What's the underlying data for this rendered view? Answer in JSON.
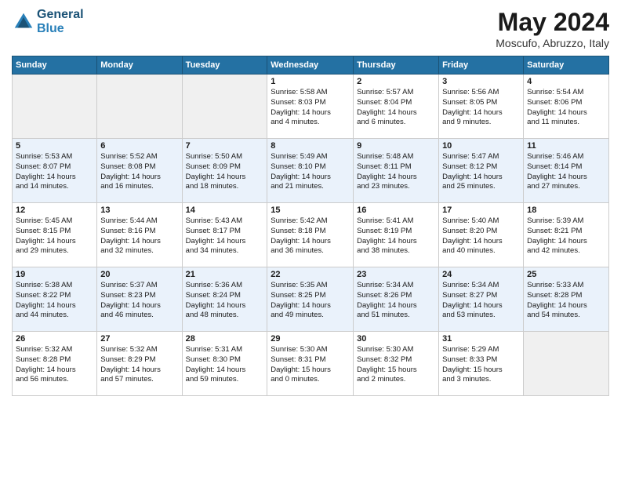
{
  "header": {
    "logo_line1": "General",
    "logo_line2": "Blue",
    "month_year": "May 2024",
    "location": "Moscufo, Abruzzo, Italy"
  },
  "days_of_week": [
    "Sunday",
    "Monday",
    "Tuesday",
    "Wednesday",
    "Thursday",
    "Friday",
    "Saturday"
  ],
  "weeks": [
    [
      {
        "day": "",
        "info": ""
      },
      {
        "day": "",
        "info": ""
      },
      {
        "day": "",
        "info": ""
      },
      {
        "day": "1",
        "info": "Sunrise: 5:58 AM\nSunset: 8:03 PM\nDaylight: 14 hours\nand 4 minutes."
      },
      {
        "day": "2",
        "info": "Sunrise: 5:57 AM\nSunset: 8:04 PM\nDaylight: 14 hours\nand 6 minutes."
      },
      {
        "day": "3",
        "info": "Sunrise: 5:56 AM\nSunset: 8:05 PM\nDaylight: 14 hours\nand 9 minutes."
      },
      {
        "day": "4",
        "info": "Sunrise: 5:54 AM\nSunset: 8:06 PM\nDaylight: 14 hours\nand 11 minutes."
      }
    ],
    [
      {
        "day": "5",
        "info": "Sunrise: 5:53 AM\nSunset: 8:07 PM\nDaylight: 14 hours\nand 14 minutes."
      },
      {
        "day": "6",
        "info": "Sunrise: 5:52 AM\nSunset: 8:08 PM\nDaylight: 14 hours\nand 16 minutes."
      },
      {
        "day": "7",
        "info": "Sunrise: 5:50 AM\nSunset: 8:09 PM\nDaylight: 14 hours\nand 18 minutes."
      },
      {
        "day": "8",
        "info": "Sunrise: 5:49 AM\nSunset: 8:10 PM\nDaylight: 14 hours\nand 21 minutes."
      },
      {
        "day": "9",
        "info": "Sunrise: 5:48 AM\nSunset: 8:11 PM\nDaylight: 14 hours\nand 23 minutes."
      },
      {
        "day": "10",
        "info": "Sunrise: 5:47 AM\nSunset: 8:12 PM\nDaylight: 14 hours\nand 25 minutes."
      },
      {
        "day": "11",
        "info": "Sunrise: 5:46 AM\nSunset: 8:14 PM\nDaylight: 14 hours\nand 27 minutes."
      }
    ],
    [
      {
        "day": "12",
        "info": "Sunrise: 5:45 AM\nSunset: 8:15 PM\nDaylight: 14 hours\nand 29 minutes."
      },
      {
        "day": "13",
        "info": "Sunrise: 5:44 AM\nSunset: 8:16 PM\nDaylight: 14 hours\nand 32 minutes."
      },
      {
        "day": "14",
        "info": "Sunrise: 5:43 AM\nSunset: 8:17 PM\nDaylight: 14 hours\nand 34 minutes."
      },
      {
        "day": "15",
        "info": "Sunrise: 5:42 AM\nSunset: 8:18 PM\nDaylight: 14 hours\nand 36 minutes."
      },
      {
        "day": "16",
        "info": "Sunrise: 5:41 AM\nSunset: 8:19 PM\nDaylight: 14 hours\nand 38 minutes."
      },
      {
        "day": "17",
        "info": "Sunrise: 5:40 AM\nSunset: 8:20 PM\nDaylight: 14 hours\nand 40 minutes."
      },
      {
        "day": "18",
        "info": "Sunrise: 5:39 AM\nSunset: 8:21 PM\nDaylight: 14 hours\nand 42 minutes."
      }
    ],
    [
      {
        "day": "19",
        "info": "Sunrise: 5:38 AM\nSunset: 8:22 PM\nDaylight: 14 hours\nand 44 minutes."
      },
      {
        "day": "20",
        "info": "Sunrise: 5:37 AM\nSunset: 8:23 PM\nDaylight: 14 hours\nand 46 minutes."
      },
      {
        "day": "21",
        "info": "Sunrise: 5:36 AM\nSunset: 8:24 PM\nDaylight: 14 hours\nand 48 minutes."
      },
      {
        "day": "22",
        "info": "Sunrise: 5:35 AM\nSunset: 8:25 PM\nDaylight: 14 hours\nand 49 minutes."
      },
      {
        "day": "23",
        "info": "Sunrise: 5:34 AM\nSunset: 8:26 PM\nDaylight: 14 hours\nand 51 minutes."
      },
      {
        "day": "24",
        "info": "Sunrise: 5:34 AM\nSunset: 8:27 PM\nDaylight: 14 hours\nand 53 minutes."
      },
      {
        "day": "25",
        "info": "Sunrise: 5:33 AM\nSunset: 8:28 PM\nDaylight: 14 hours\nand 54 minutes."
      }
    ],
    [
      {
        "day": "26",
        "info": "Sunrise: 5:32 AM\nSunset: 8:28 PM\nDaylight: 14 hours\nand 56 minutes."
      },
      {
        "day": "27",
        "info": "Sunrise: 5:32 AM\nSunset: 8:29 PM\nDaylight: 14 hours\nand 57 minutes."
      },
      {
        "day": "28",
        "info": "Sunrise: 5:31 AM\nSunset: 8:30 PM\nDaylight: 14 hours\nand 59 minutes."
      },
      {
        "day": "29",
        "info": "Sunrise: 5:30 AM\nSunset: 8:31 PM\nDaylight: 15 hours\nand 0 minutes."
      },
      {
        "day": "30",
        "info": "Sunrise: 5:30 AM\nSunset: 8:32 PM\nDaylight: 15 hours\nand 2 minutes."
      },
      {
        "day": "31",
        "info": "Sunrise: 5:29 AM\nSunset: 8:33 PM\nDaylight: 15 hours\nand 3 minutes."
      },
      {
        "day": "",
        "info": ""
      }
    ]
  ]
}
